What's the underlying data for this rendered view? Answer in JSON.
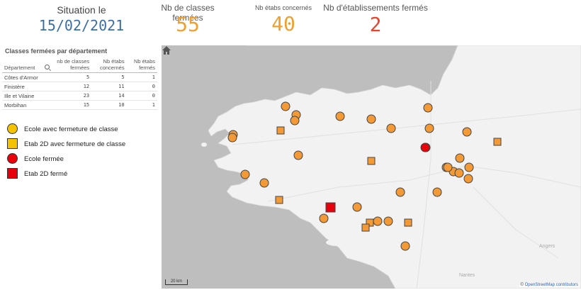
{
  "header": {
    "situation_label": "Situation le",
    "situation_date": "15/02/2021",
    "kpi1_label": "Nb de classes fermées",
    "kpi1_value": "55",
    "kpi2_label": "Nb étabs concernés",
    "kpi2_value": "40",
    "kpi3_label": "Nb d'établissements fermés",
    "kpi3_value": "2"
  },
  "table": {
    "title": "Classes fermées par département",
    "headers": [
      "Département",
      "nb de classes fermées",
      "Nb étabs concernés",
      "Nb étabs fermés"
    ],
    "rows": [
      [
        "Côtes d'Armor",
        "5",
        "5",
        "1"
      ],
      [
        "Finistère",
        "12",
        "11",
        "0"
      ],
      [
        "Ille et Vilaine",
        "23",
        "14",
        "0"
      ],
      [
        "Morbihan",
        "15",
        "10",
        "1"
      ]
    ]
  },
  "legend": [
    {
      "label": "Ecole avec fermeture de classe",
      "shape": "circle",
      "color": "#f5c200"
    },
    {
      "label": "Etab 2D avec fermeture de classe",
      "shape": "square",
      "color": "#f5c200"
    },
    {
      "label": "Ecole fermée",
      "shape": "circle",
      "color": "#e8000b"
    },
    {
      "label": "Etab 2D fermé",
      "shape": "square",
      "color": "#e8000b"
    }
  ],
  "map": {
    "marker_color": "#f39a36",
    "closed_color": "#e8000b",
    "cities": [
      "Angers",
      "Nantes"
    ],
    "scale_label": "20 km",
    "attribution_prefix": "©",
    "attribution_link": "OpenStreetMap contributors"
  }
}
